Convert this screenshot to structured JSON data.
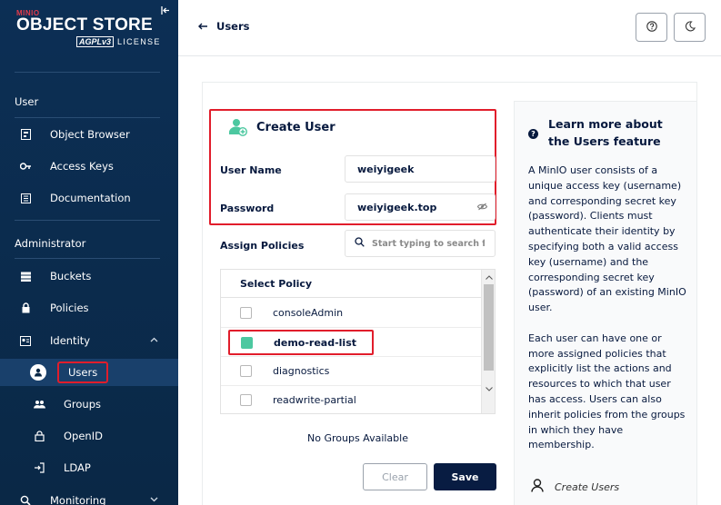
{
  "sidebar": {
    "logo": {
      "brand": "MINIO",
      "product": "OBJECT STORE",
      "agpl": "AGPLv3",
      "license": "LICENSE"
    },
    "sections": {
      "user": "User",
      "administrator": "Administrator"
    },
    "items": {
      "object_browser": "Object Browser",
      "access_keys": "Access Keys",
      "documentation": "Documentation",
      "buckets": "Buckets",
      "policies": "Policies",
      "identity": "Identity",
      "users": "Users",
      "groups": "Groups",
      "openid": "OpenID",
      "ldap": "LDAP",
      "monitoring": "Monitoring"
    }
  },
  "header": {
    "back_label": "Users"
  },
  "form": {
    "title": "Create User",
    "username_label": "User Name",
    "username_value": "weiyigeek",
    "password_label": "Password",
    "password_value": "weiyigeek.top",
    "assign_policies_label": "Assign Policies",
    "search_placeholder": "Start typing to search for",
    "policy_table_header": "Select Policy",
    "policies": [
      {
        "name": "consoleAdmin",
        "checked": false
      },
      {
        "name": "demo-read-list",
        "checked": true
      },
      {
        "name": "diagnostics",
        "checked": false
      },
      {
        "name": "readwrite-partial",
        "checked": false
      }
    ],
    "no_groups": "No Groups Available",
    "clear_label": "Clear",
    "save_label": "Save"
  },
  "help": {
    "title": "Learn more about the Users feature",
    "paragraph1": "A MinIO user consists of a unique access key (username) and corresponding secret key (password). Clients must authenticate their identity by specifying both a valid access key (username) and the corresponding secret key (password) of an existing MinIO user.",
    "paragraph2": "Each user can have one or more assigned policies that explicitly list the actions and resources to which that user has access. Users can also inherit policies from the groups in which they have membership.",
    "link": "Create Users"
  },
  "colors": {
    "sidebar_bg": "#0b2c4f",
    "highlight": "#e11d2b",
    "checked": "#4cc8a0",
    "primary": "#081c42"
  }
}
